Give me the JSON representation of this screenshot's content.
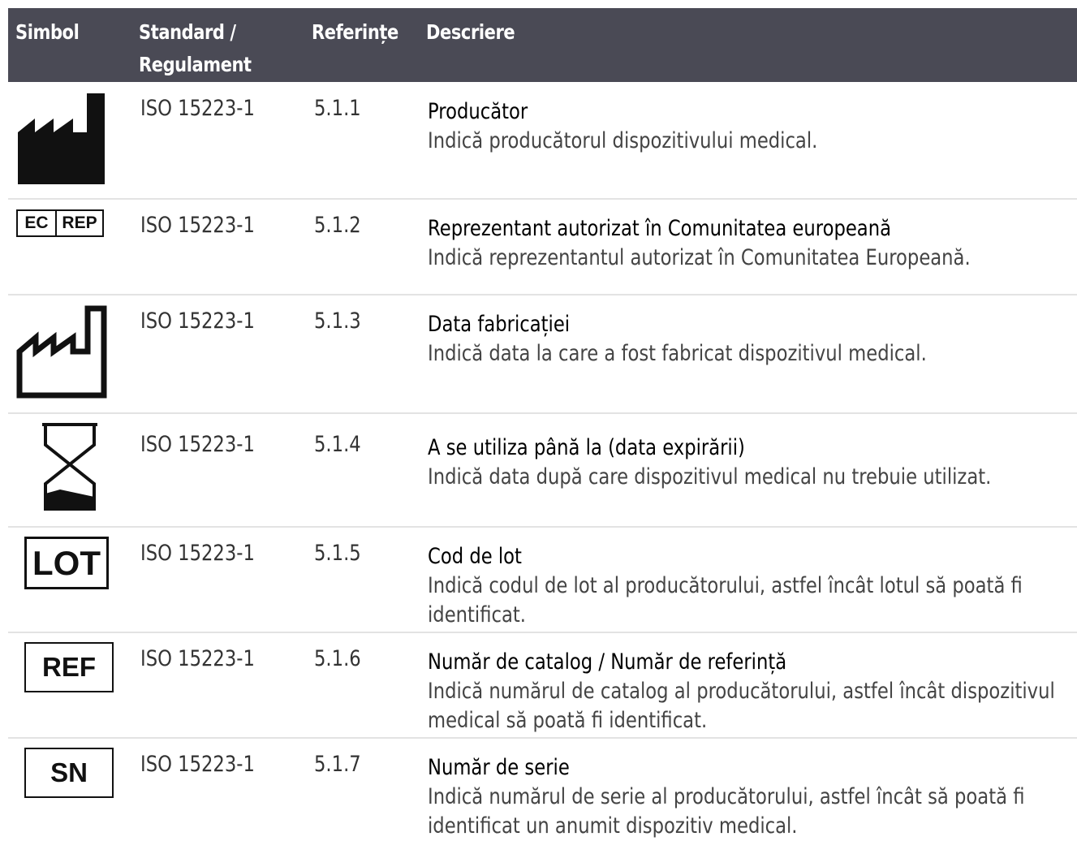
{
  "header": {
    "col_symbol": "Simbol",
    "col_standard": "Standard /\nRegulament",
    "col_reference": "Referințe",
    "col_description": "Descriere"
  },
  "rows": [
    {
      "symbol_icon": "manufacturer-icon",
      "standard": "ISO 15223-1",
      "reference": "5.1.1",
      "title": "Producător",
      "text": "Indică producătorul dispozitivului medical."
    },
    {
      "symbol_icon": "ec-rep-icon",
      "symbol_text_a": "EC",
      "symbol_text_b": "REP",
      "standard": "ISO 15223-1",
      "reference": "5.1.2",
      "title": "Reprezentant autorizat în Comunitatea europeană",
      "text": "Indică reprezentantul autorizat în Comunitatea Europeană."
    },
    {
      "symbol_icon": "date-of-manufacture-icon",
      "standard": "ISO 15223-1",
      "reference": "5.1.3",
      "title": "Data fabricației",
      "text": "Indică data la care a fost fabricat dispozitivul medical."
    },
    {
      "symbol_icon": "hourglass-icon",
      "standard": "ISO 15223-1",
      "reference": "5.1.4",
      "title": "A se utiliza până la (data expirării)",
      "text": "Indică data după care dispozitivul medical nu trebuie utilizat."
    },
    {
      "symbol_icon": "lot-icon",
      "symbol_text": "LOT",
      "standard": "ISO 15223-1",
      "reference": "5.1.5",
      "title": "Cod de lot",
      "text": "Indică codul de lot al producătorului, astfel încât lotul să poată fi identificat."
    },
    {
      "symbol_icon": "ref-icon",
      "symbol_text": "REF",
      "standard": "ISO 15223-1",
      "reference": "5.1.6",
      "title": "Număr de catalog / Număr de referință",
      "text": "Indică numărul de catalog al producătorului, astfel încât dispozitivul medical să poată fi identificat."
    },
    {
      "symbol_icon": "sn-icon",
      "symbol_text": "SN",
      "standard": "ISO 15223-1",
      "reference": "5.1.7",
      "title": "Număr de serie",
      "text": "Indică numărul de serie al producătorului, astfel încât să poată fi identificat un anumit dispozitiv medical."
    }
  ]
}
